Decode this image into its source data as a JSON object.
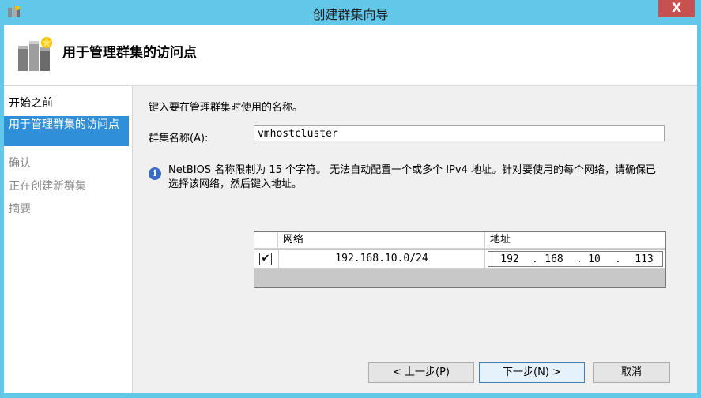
{
  "window": {
    "title": "创建群集向导",
    "close_glyph": "X"
  },
  "header": {
    "title": "用于管理群集的访问点",
    "icon": "cluster-wizard-icon"
  },
  "sidebar": {
    "items": [
      {
        "label": "开始之前",
        "state": "done"
      },
      {
        "label": "用于管理群集的访问点",
        "state": "active"
      },
      {
        "label": "确认",
        "state": "pending"
      },
      {
        "label": "正在创建新群集",
        "state": "pending"
      },
      {
        "label": "摘要",
        "state": "pending"
      }
    ]
  },
  "content": {
    "instruction": "键入要在管理群集时使用的名称。",
    "cluster_name_label": "群集名称(A):",
    "cluster_name_value": "vmhostcluster",
    "info_text": "NetBIOS 名称限制为 15 个字符。 无法自动配置一个或多个 IPv4 地址。针对要使用的每个网络，请确保已选择该网络，然后键入地址。",
    "grid": {
      "columns": [
        "网络",
        "地址"
      ],
      "rows": [
        {
          "checked": true,
          "check_glyph": "✔",
          "network": "192.168.10.0/24",
          "address": [
            "192",
            "168",
            "10",
            "113"
          ]
        }
      ]
    }
  },
  "buttons": {
    "back": "< 上一步(P)",
    "next": "下一步(N) >",
    "cancel": "取消"
  },
  "colors": {
    "titlebar": "#63c7e9",
    "active_step": "#2f8fd8",
    "close": "#c75050"
  }
}
